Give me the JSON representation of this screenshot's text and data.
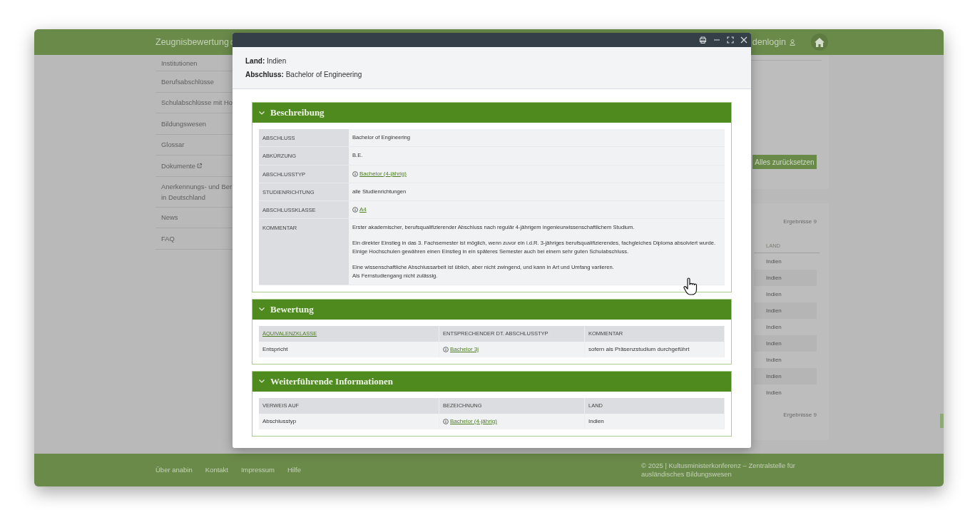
{
  "header": {
    "title": "Zeugnisbewertung",
    "login": "denlogin"
  },
  "sidebar": {
    "items": [
      {
        "lines": [
          "Institutionen"
        ]
      },
      {
        "lines": [
          "Berufsabschlüsse"
        ]
      },
      {
        "lines": [
          "Schulabschlüsse mit Ho"
        ]
      },
      {
        "lines": [
          "Bildungswesen"
        ]
      },
      {
        "lines": [
          "Glossar"
        ]
      },
      {
        "lines": [
          "Dokumente"
        ],
        "external": true
      },
      {
        "lines": [
          "Anerkennungs- und Ber",
          "in Deutschland"
        ]
      },
      {
        "lines": [
          "News"
        ]
      },
      {
        "lines": [
          "FAQ"
        ]
      }
    ]
  },
  "filter_panel": {
    "reset_button": "Alles zurücksetzen"
  },
  "results": {
    "count_top": "Ergebnisse 9",
    "column": "LAND",
    "rows": [
      "Indien",
      "Indien",
      "Indien",
      "Indien",
      "Indien",
      "Indien",
      "Indien",
      "Indien",
      "Indien"
    ],
    "count_bottom": "Ergebnisse 9"
  },
  "modal": {
    "meta": [
      {
        "label": "Land:",
        "value": "Indien"
      },
      {
        "label": "Abschluss:",
        "value": "Bachelor of Engineering"
      }
    ],
    "sections": [
      {
        "title": "Beschreibung",
        "expanded": true,
        "kind": "definition",
        "rows": [
          {
            "label": "ABSCHLUSS",
            "kind": "text",
            "paragraphs": [
              [
                "Bachelor of Engineering"
              ]
            ]
          },
          {
            "label": "ABKÜRZUNG",
            "kind": "text",
            "paragraphs": [
              [
                "B.E."
              ]
            ]
          },
          {
            "label": "ABSCHLUSSTYP",
            "kind": "link",
            "link": "Bachelor (4-jährig)"
          },
          {
            "label": "STUDIENRICHTUNG",
            "kind": "text",
            "paragraphs": [
              [
                "alle Studienrichtungen"
              ]
            ]
          },
          {
            "label": "ABSCHLUSSKLASSE",
            "kind": "link",
            "link": "A4"
          },
          {
            "label": "KOMMENTAR",
            "kind": "text",
            "paragraphs": [
              [
                "Erster akademischer, berufsqualifizierender Abschluss nach regulär 4-jährigem ingenieurwissenschaftlichem Studium."
              ],
              [
                "Ein direkter Einstieg in das 3. Fachsemester ist möglich, wenn zuvor ein i.d.R. 3-jähriges berufsqualifizierendes, fachgleiches Diploma absolviert wurde.",
                "Einige Hochschulen gewähren einen Einstieg in ein späteres Semester auch bei einem sehr guten Schulabschluss."
              ],
              [
                "Eine wissenschaftliche Abschlussarbeit ist üblich, aber nicht zwingend, und kann in Art und Umfang variieren.",
                "Als Fernstudiengang nicht zulässig."
              ]
            ]
          }
        ]
      },
      {
        "title": "Bewertung",
        "expanded": true,
        "kind": "table",
        "columns": [
          {
            "label": "ÄQUIVALENZKLASSE",
            "link": true
          },
          {
            "label": "ENTSPRECHENDER DT. ABSCHLUSSTYP",
            "link": false
          },
          {
            "label": "KOMMENTAR",
            "link": false
          }
        ],
        "rows": [
          [
            {
              "kind": "text",
              "text": "Entspricht"
            },
            {
              "kind": "link",
              "text": "Bachelor 3j"
            },
            {
              "kind": "text",
              "text": "sofern als Präsenzstudium durchgeführt"
            }
          ]
        ]
      },
      {
        "title": "Weiterführende Informationen",
        "expanded": true,
        "kind": "table",
        "columns": [
          {
            "label": "VERWEIS AUF",
            "link": false
          },
          {
            "label": "BEZEICHNUNG",
            "link": false
          },
          {
            "label": "LAND",
            "link": false
          }
        ],
        "rows": [
          [
            {
              "kind": "text",
              "text": "Abschlusstyp"
            },
            {
              "kind": "link",
              "text": "Bachelor (4-jährig)"
            },
            {
              "kind": "text",
              "text": "Indien"
            }
          ]
        ]
      }
    ]
  },
  "footer": {
    "links": [
      "Über anabin",
      "Kontakt",
      "Impressum",
      "Hilfe"
    ],
    "copyright": [
      "© 2025 | Kultusministerkonferenz – Zentralstelle für",
      "ausländisches Bildungswesen"
    ]
  }
}
